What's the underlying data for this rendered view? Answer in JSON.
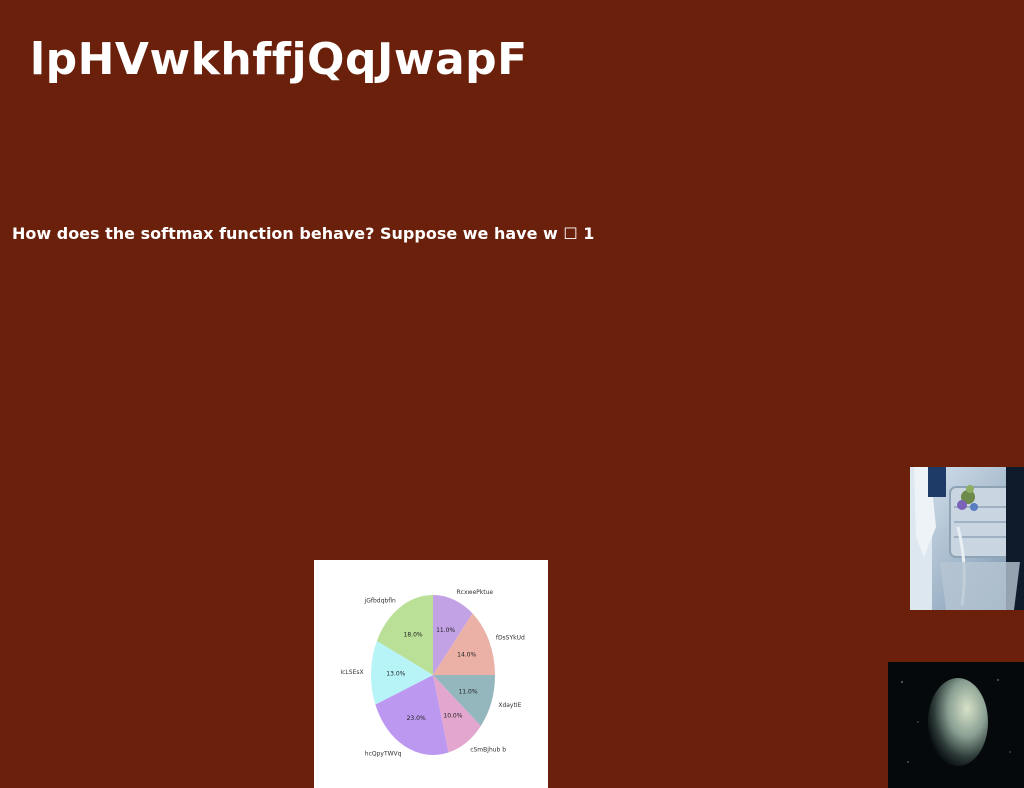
{
  "page": {
    "title": "lpHVwkhffjQqJwapF",
    "question": "How does the softmax function behave? Suppose we have w ☐ 1",
    "background": "#6b200b"
  },
  "images": {
    "cart": "shopping-cart-with-flowers-photo",
    "planet": "planet-in-space-photo"
  },
  "chart_data": {
    "type": "pie",
    "labels": [
      "RcxwePktue",
      "fDsSYkUd",
      "XdaytIE",
      "cSmBjhub b",
      "hcQpyTWVq",
      "IcLSEsX",
      "jGfbdqbfln"
    ],
    "values": [
      11.0,
      14.0,
      11.0,
      10.0,
      23.0,
      13.0,
      18.0
    ],
    "percent_labels": [
      "11.0%",
      "14.0%",
      "11.0%",
      "10.0%",
      "23.0%",
      "13.0%",
      "18.0%"
    ],
    "colors": [
      "#c2a2e4",
      "#ebb1a6",
      "#94b6bd",
      "#e3a6ce",
      "#bc98f0",
      "#b6f4f8",
      "#b9e096"
    ],
    "start_angle_deg": 90,
    "direction": "clockwise"
  }
}
